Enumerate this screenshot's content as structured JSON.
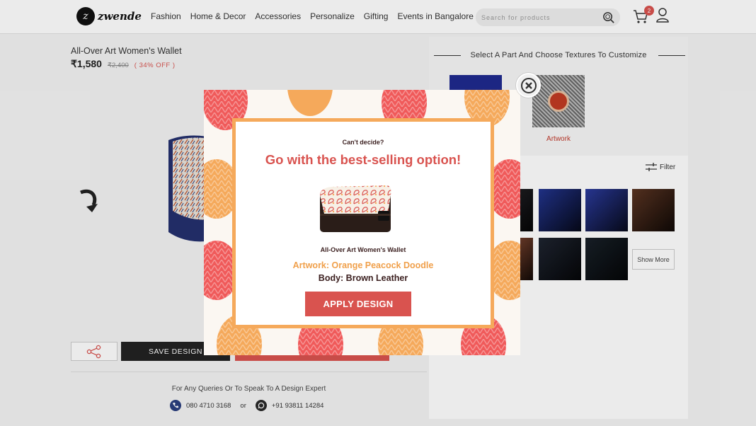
{
  "header": {
    "logo_text": "zwende",
    "nav": [
      "Fashion",
      "Home & Decor",
      "Accessories",
      "Personalize",
      "Gifting",
      "Events in Bangalore"
    ],
    "search_placeholder": "Search for products",
    "cart_count": "2"
  },
  "product": {
    "title": "All-Over Art Women's Wallet",
    "price": "₹1,580",
    "mrp": "₹2,400",
    "discount": "( 34% OFF )",
    "save_label": "SAVE DESIGN",
    "query_text": "For Any Queries Or To Speak To A Design Expert",
    "phone": "080 4710 3168",
    "or_text": "or",
    "whatsapp": "+91 93811 14284"
  },
  "customize": {
    "title": "Select A Part And Choose Textures To Customize",
    "artwork_label": "Artwork",
    "filter_label": "Filter",
    "show_more": "Show More",
    "swatch_colors": [
      "#1b1b1f",
      "#22348f",
      "#2a3a9c",
      "#5a3422",
      "#6a3a28",
      "#1e2430",
      "#182028"
    ]
  },
  "modal": {
    "cant_decide": "Can't decide?",
    "headline": "Go with the best-selling option!",
    "wallet_name": "All-Over Art Women's Wallet",
    "artwork": "Artwork: Orange Peacock Doodle",
    "body": "Body: Brown Leather",
    "apply_label": "APPLY DESIGN"
  },
  "colors": {
    "accent": "#d9534f",
    "orange": "#f5a95b",
    "dark": "#3b1f1f"
  }
}
